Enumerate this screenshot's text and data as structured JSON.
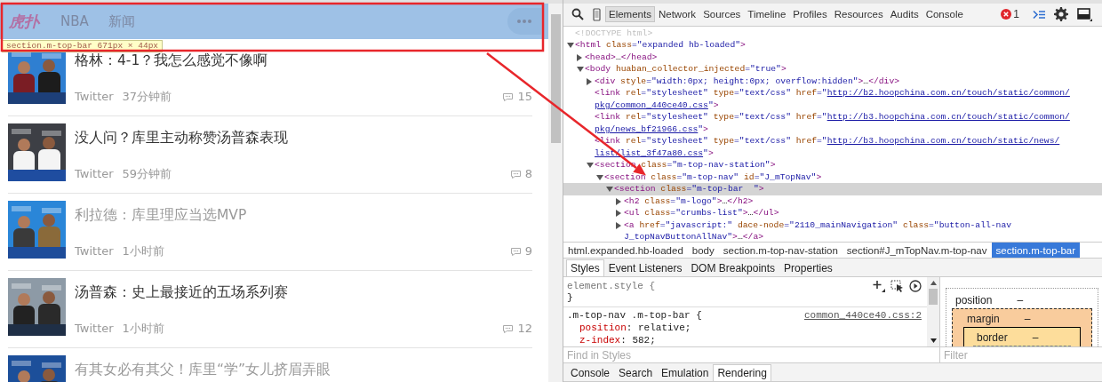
{
  "page": {
    "logo": "虎扑",
    "nav": [
      {
        "label": "NBA"
      },
      {
        "label": "新闻"
      }
    ],
    "tooltip": "section.m-top-bar 671px × 44px",
    "articles": [
      {
        "title": "格林：4-1？我怎么感觉不像啊",
        "read": false,
        "source": "Twitter",
        "time": "37分钟前",
        "comments": "15"
      },
      {
        "title": "没人问？库里主动称赞汤普森表现",
        "read": false,
        "source": "Twitter",
        "time": "59分钟前",
        "comments": "8"
      },
      {
        "title": "利拉德：库里理应当选MVP",
        "read": true,
        "source": "Twitter",
        "time": "1小时前",
        "comments": "9"
      },
      {
        "title": "汤普森：史上最接近的五场系列赛",
        "read": false,
        "source": "Twitter",
        "time": "1小时前",
        "comments": "12"
      },
      {
        "title": "有其女必有其父！库里“学”女儿挤眉弄眼",
        "read": true
      }
    ]
  },
  "devtools": {
    "tabs": [
      {
        "label": "Elements",
        "selected": true
      },
      {
        "label": "Network",
        "selected": false
      },
      {
        "label": "Sources",
        "selected": false
      },
      {
        "label": "Timeline",
        "selected": false
      },
      {
        "label": "Profiles",
        "selected": false
      },
      {
        "label": "Resources",
        "selected": false
      },
      {
        "label": "Audits",
        "selected": false
      },
      {
        "label": "Console",
        "selected": false
      }
    ],
    "error_count": "1",
    "dom": [
      {
        "kind": "leaf",
        "selected": false,
        "lines": [
          [
            {
              "kind": "doctype",
              "text": "<!DOCTYPE html>"
            }
          ]
        ]
      },
      {
        "kind": "element",
        "expanded": true,
        "selected": false,
        "lines": [
          [
            {
              "kind": "tag",
              "text": "<html"
            },
            {
              "kind": "attr",
              "text": " class"
            },
            {
              "kind": "value",
              "text": "=\"expanded hb-loaded\""
            },
            {
              "kind": "tag",
              "text": ">"
            }
          ]
        ],
        "children": [
          {
            "kind": "element",
            "expanded": false,
            "selected": false,
            "lines": [
              [
                {
                  "kind": "tag",
                  "text": "<head>"
                },
                {
                  "kind": "plain",
                  "text": "…"
                },
                {
                  "kind": "tag",
                  "text": "</head>"
                }
              ]
            ]
          },
          {
            "kind": "element",
            "expanded": true,
            "selected": false,
            "lines": [
              [
                {
                  "kind": "tag",
                  "text": "<body"
                },
                {
                  "kind": "attr",
                  "text": " huaban_collector_injected"
                },
                {
                  "kind": "value",
                  "text": "=\"true\""
                },
                {
                  "kind": "tag",
                  "text": ">"
                }
              ]
            ],
            "children": [
              {
                "kind": "element",
                "expanded": false,
                "selected": false,
                "lines": [
                  [
                    {
                      "kind": "tag",
                      "text": "<div"
                    },
                    {
                      "kind": "attr",
                      "text": " style"
                    },
                    {
                      "kind": "value",
                      "text": "=\"width:0px; height:0px; overflow:hidden\""
                    },
                    {
                      "kind": "tag",
                      "text": ">"
                    },
                    {
                      "kind": "plain",
                      "text": "…"
                    },
                    {
                      "kind": "tag",
                      "text": "</div>"
                    }
                  ]
                ]
              },
              {
                "kind": "leaf",
                "selected": false,
                "lines": [
                  [
                    {
                      "kind": "tag",
                      "text": "<link"
                    },
                    {
                      "kind": "attr",
                      "text": " rel"
                    },
                    {
                      "kind": "value",
                      "text": "=\"stylesheet\""
                    },
                    {
                      "kind": "attr",
                      "text": " type"
                    },
                    {
                      "kind": "value",
                      "text": "=\"text/css\""
                    },
                    {
                      "kind": "attr",
                      "text": " href"
                    },
                    {
                      "kind": "value",
                      "text": "=\""
                    },
                    {
                      "kind": "link",
                      "text": "http://b2.hoopchina.com.cn/touch/static/common/"
                    }
                  ],
                  [
                    {
                      "kind": "link",
                      "text": "pkg/common_440ce40.css"
                    },
                    {
                      "kind": "value",
                      "text": "\""
                    },
                    {
                      "kind": "tag",
                      "text": ">"
                    }
                  ]
                ]
              },
              {
                "kind": "leaf",
                "selected": false,
                "lines": [
                  [
                    {
                      "kind": "tag",
                      "text": "<link"
                    },
                    {
                      "kind": "attr",
                      "text": " rel"
                    },
                    {
                      "kind": "value",
                      "text": "=\"stylesheet\""
                    },
                    {
                      "kind": "attr",
                      "text": " type"
                    },
                    {
                      "kind": "value",
                      "text": "=\"text/css\""
                    },
                    {
                      "kind": "attr",
                      "text": " href"
                    },
                    {
                      "kind": "value",
                      "text": "=\""
                    },
                    {
                      "kind": "link",
                      "text": "http://b3.hoopchina.com.cn/touch/static/common/"
                    }
                  ],
                  [
                    {
                      "kind": "link",
                      "text": "pkg/news_bf21966.css"
                    },
                    {
                      "kind": "value",
                      "text": "\""
                    },
                    {
                      "kind": "tag",
                      "text": ">"
                    }
                  ]
                ]
              },
              {
                "kind": "leaf",
                "selected": false,
                "lines": [
                  [
                    {
                      "kind": "tag",
                      "text": "<link"
                    },
                    {
                      "kind": "attr",
                      "text": " rel"
                    },
                    {
                      "kind": "value",
                      "text": "=\"stylesheet\""
                    },
                    {
                      "kind": "attr",
                      "text": " type"
                    },
                    {
                      "kind": "value",
                      "text": "=\"text/css\""
                    },
                    {
                      "kind": "attr",
                      "text": " href"
                    },
                    {
                      "kind": "value",
                      "text": "=\""
                    },
                    {
                      "kind": "link",
                      "text": "http://b3.hoopchina.com.cn/touch/static/news/"
                    }
                  ],
                  [
                    {
                      "kind": "link",
                      "text": "list/list_3f47a80.css"
                    },
                    {
                      "kind": "value",
                      "text": "\""
                    },
                    {
                      "kind": "tag",
                      "text": ">"
                    }
                  ]
                ]
              },
              {
                "kind": "element",
                "expanded": true,
                "selected": false,
                "lines": [
                  [
                    {
                      "kind": "tag",
                      "text": "<section"
                    },
                    {
                      "kind": "attr",
                      "text": " class"
                    },
                    {
                      "kind": "value",
                      "text": "=\"m-top-nav-station\""
                    },
                    {
                      "kind": "tag",
                      "text": ">"
                    }
                  ]
                ],
                "children": [
                  {
                    "kind": "element",
                    "expanded": true,
                    "selected": false,
                    "lines": [
                      [
                        {
                          "kind": "tag",
                          "text": "<section"
                        },
                        {
                          "kind": "attr",
                          "text": " class"
                        },
                        {
                          "kind": "value",
                          "text": "=\"m-top-nav\""
                        },
                        {
                          "kind": "attr",
                          "text": " id"
                        },
                        {
                          "kind": "value",
                          "text": "=\"J_mTopNav\""
                        },
                        {
                          "kind": "tag",
                          "text": ">"
                        }
                      ]
                    ],
                    "children": [
                      {
                        "kind": "element",
                        "expanded": true,
                        "selected": true,
                        "lines": [
                          [
                            {
                              "kind": "tag",
                              "text": "<section"
                            },
                            {
                              "kind": "attr",
                              "text": " class"
                            },
                            {
                              "kind": "value",
                              "text": "=\"m-top-bar  \""
                            },
                            {
                              "kind": "tag",
                              "text": ">"
                            }
                          ]
                        ],
                        "children": [
                          {
                            "kind": "element",
                            "expanded": false,
                            "selected": false,
                            "lines": [
                              [
                                {
                                  "kind": "tag",
                                  "text": "<h2"
                                },
                                {
                                  "kind": "attr",
                                  "text": " class"
                                },
                                {
                                  "kind": "value",
                                  "text": "=\"m-logo\""
                                },
                                {
                                  "kind": "tag",
                                  "text": ">"
                                },
                                {
                                  "kind": "plain",
                                  "text": "…"
                                },
                                {
                                  "kind": "tag",
                                  "text": "</h2>"
                                }
                              ]
                            ]
                          },
                          {
                            "kind": "element",
                            "expanded": false,
                            "selected": false,
                            "lines": [
                              [
                                {
                                  "kind": "tag",
                                  "text": "<ul"
                                },
                                {
                                  "kind": "attr",
                                  "text": " class"
                                },
                                {
                                  "kind": "value",
                                  "text": "=\"crumbs-list\""
                                },
                                {
                                  "kind": "tag",
                                  "text": ">"
                                },
                                {
                                  "kind": "plain",
                                  "text": "…"
                                },
                                {
                                  "kind": "tag",
                                  "text": "</ul>"
                                }
                              ]
                            ]
                          },
                          {
                            "kind": "element",
                            "expanded": false,
                            "selected": false,
                            "lines": [
                              [
                                {
                                  "kind": "tag",
                                  "text": "<a"
                                },
                                {
                                  "kind": "attr",
                                  "text": " href"
                                },
                                {
                                  "kind": "value",
                                  "text": "=\"javascript:\""
                                },
                                {
                                  "kind": "attr",
                                  "text": " dace-node"
                                },
                                {
                                  "kind": "value",
                                  "text": "=\"2110_mainNavigation\""
                                },
                                {
                                  "kind": "attr",
                                  "text": " class"
                                },
                                {
                                  "kind": "value",
                                  "text": "=\"button-all-nav"
                                }
                              ],
                              [
                                {
                                  "kind": "value",
                                  "text": "J_topNavButtonAllNav\""
                                },
                                {
                                  "kind": "tag",
                                  "text": ">"
                                },
                                {
                                  "kind": "plain",
                                  "text": "…"
                                },
                                {
                                  "kind": "tag",
                                  "text": "</a>"
                                }
                              ]
                            ]
                          }
                        ]
                      }
                    ]
                  }
                ]
              }
            ]
          }
        ]
      }
    ],
    "breadcrumbs": [
      {
        "label": "html.expanded.hb-loaded",
        "selected": false
      },
      {
        "label": "body",
        "selected": false
      },
      {
        "label": "section.m-top-nav-station",
        "selected": false
      },
      {
        "label": "section#J_mTopNav.m-top-nav",
        "selected": false
      },
      {
        "label": "section.m-top-bar",
        "selected": true
      }
    ],
    "styles_tabs": [
      {
        "label": "Styles",
        "selected": true
      },
      {
        "label": "Event Listeners",
        "selected": false
      },
      {
        "label": "DOM Breakpoints",
        "selected": false
      },
      {
        "label": "Properties",
        "selected": false
      }
    ],
    "element_style": {
      "open": "element.style {",
      "close": "}"
    },
    "rule": {
      "selector": ".m-top-nav .m-top-bar {",
      "source": "common_440ce40.css:2",
      "declarations": [
        {
          "name": "position",
          "text": ": relative;"
        },
        {
          "name": "z-index",
          "text": ": 582;"
        }
      ]
    },
    "find_placeholder": "Find in Styles",
    "box_model": [
      {
        "label": "position",
        "value": "–"
      },
      {
        "label": "margin",
        "value": "–"
      },
      {
        "label": "border",
        "value": "–"
      }
    ],
    "filter_placeholder": "Filter",
    "drawer_tabs": [
      {
        "label": "Console",
        "selected": false
      },
      {
        "label": "Search",
        "selected": false
      },
      {
        "label": "Emulation",
        "selected": false
      },
      {
        "label": "Rendering",
        "selected": true
      }
    ]
  }
}
